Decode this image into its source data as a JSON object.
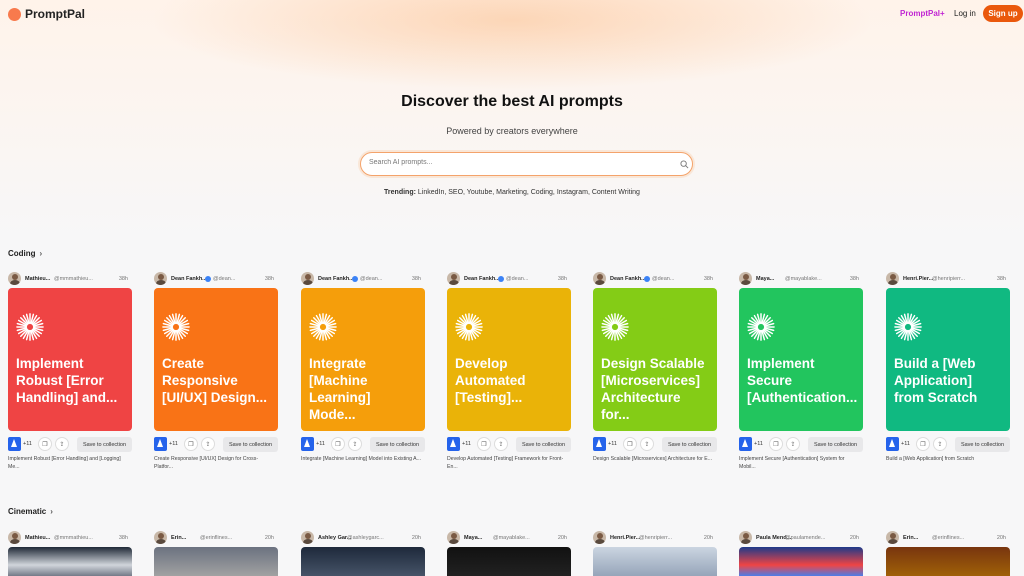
{
  "app": {
    "name": "PromptPal"
  },
  "nav": {
    "plus": "PromptPal+",
    "login": "Log in",
    "signup": "Sign up"
  },
  "hero": {
    "title": "Discover the best AI prompts",
    "subtitle": "Powered by creators everywhere"
  },
  "search": {
    "placeholder": "Search AI prompts..."
  },
  "trending": {
    "label": "Trending:",
    "items": "LinkedIn, SEO, Youtube, Marketing, Coding, Instagram, Content Writing"
  },
  "sections": [
    {
      "title": "Coding",
      "cards": [
        {
          "name": "Mathieu...",
          "handle": "@mmmathieu...",
          "time": "38h",
          "verified": false,
          "title": "Implement Robust [Error Handling] and...",
          "count": "+11",
          "save": "Save to collection",
          "desc": "Implement Robust [Error Handling] and [Logging] Me...",
          "color": "#ef4444"
        },
        {
          "name": "Dean Fankh...",
          "handle": "@dean...",
          "time": "38h",
          "verified": true,
          "title": "Create Responsive [UI/UX] Design...",
          "count": "+11",
          "save": "Save to collection",
          "desc": "Create Responsive [UI/UX] Design for Cross-Platfor...",
          "color": "#f97316"
        },
        {
          "name": "Dean Fankh...",
          "handle": "@dean...",
          "time": "38h",
          "verified": true,
          "title": "Integrate [Machine Learning] Mode...",
          "count": "+11",
          "save": "Save to collection",
          "desc": "Integrate [Machine Learning] Model into Existing A...",
          "color": "#f59e0b"
        },
        {
          "name": "Dean Fankh...",
          "handle": "@dean...",
          "time": "38h",
          "verified": true,
          "title": "Develop Automated [Testing]...",
          "count": "+11",
          "save": "Save to collection",
          "desc": "Develop Automated [Testing] Framework for Front-En...",
          "color": "#eab308"
        },
        {
          "name": "Dean Fankh...",
          "handle": "@dean...",
          "time": "38h",
          "verified": true,
          "title": "Design Scalable [Microservices] Architecture for...",
          "count": "+11",
          "save": "Save to collection",
          "desc": "Design Scalable [Microservices] Architecture for E...",
          "color": "#84cc16"
        },
        {
          "name": "Maya...",
          "handle": "@mayablake...",
          "time": "38h",
          "verified": false,
          "title": "Implement Secure [Authentication...",
          "count": "+11",
          "save": "Save to collection",
          "desc": "Implement Secure [Authentication] System for Mobil...",
          "color": "#22c55e"
        },
        {
          "name": "Henri.Pier...",
          "handle": "@henripierr...",
          "time": "38h",
          "verified": false,
          "title": "Build a [Web Application] from Scratch",
          "count": "+11",
          "save": "Save to collection",
          "desc": "Build a [Web Application] from Scratch",
          "color": "#10b981"
        }
      ]
    },
    {
      "title": "Cinematic",
      "cards": [
        {
          "name": "Mathieu...",
          "handle": "@mmmathieu...",
          "time": "38h"
        },
        {
          "name": "Erin...",
          "handle": "@erinflines...",
          "time": "20h"
        },
        {
          "name": "Ashley Gar...",
          "handle": "@ashleygarc...",
          "time": "20h"
        },
        {
          "name": "Maya...",
          "handle": "@mayablake...",
          "time": "20h"
        },
        {
          "name": "Henri.Pier...",
          "handle": "@henripierr...",
          "time": "20h"
        },
        {
          "name": "Paula Mend...",
          "handle": "@paulamende...",
          "time": "20h"
        },
        {
          "name": "Erin...",
          "handle": "@erinflines...",
          "time": "20h"
        }
      ]
    }
  ]
}
